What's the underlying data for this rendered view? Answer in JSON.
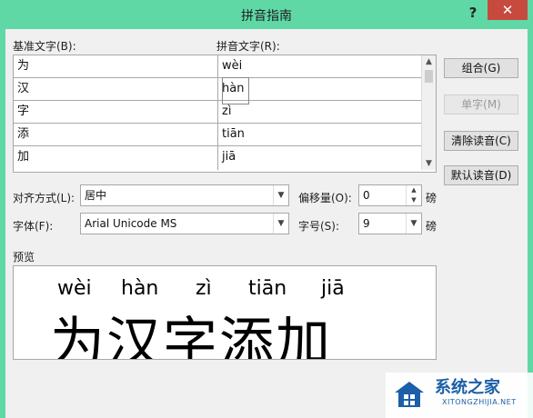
{
  "window": {
    "title": "拼音指南",
    "help": "?",
    "close": "✕"
  },
  "labels": {
    "base_text": "基准文字(B):",
    "pinyin_text": "拼音文字(R):",
    "align": "对齐方式(L):",
    "offset": "偏移量(O):",
    "font": "字体(F):",
    "size": "字号(S):",
    "preview": "预览",
    "unit": "磅"
  },
  "rows": [
    {
      "base": "为",
      "pinyin": "wèi"
    },
    {
      "base": "汉",
      "pinyin": "hàn"
    },
    {
      "base": "字",
      "pinyin": "zì"
    },
    {
      "base": "添",
      "pinyin": "tiān"
    },
    {
      "base": "加",
      "pinyin": "jiā"
    }
  ],
  "buttons": {
    "combine": "组合(G)",
    "single": "单字(M)",
    "clear": "清除读音(C)",
    "default": "默认读音(D)"
  },
  "fields": {
    "align_value": "居中",
    "offset_value": "0",
    "font_value": "Arial Unicode MS",
    "size_value": "9"
  },
  "preview": {
    "pinyin": [
      "wèi",
      "hàn",
      "zì",
      "tiān",
      "jiā"
    ],
    "text": "为汉字添加"
  },
  "watermark": {
    "title": "系统之家",
    "sub": "XITONGZHIJIA.NET"
  }
}
